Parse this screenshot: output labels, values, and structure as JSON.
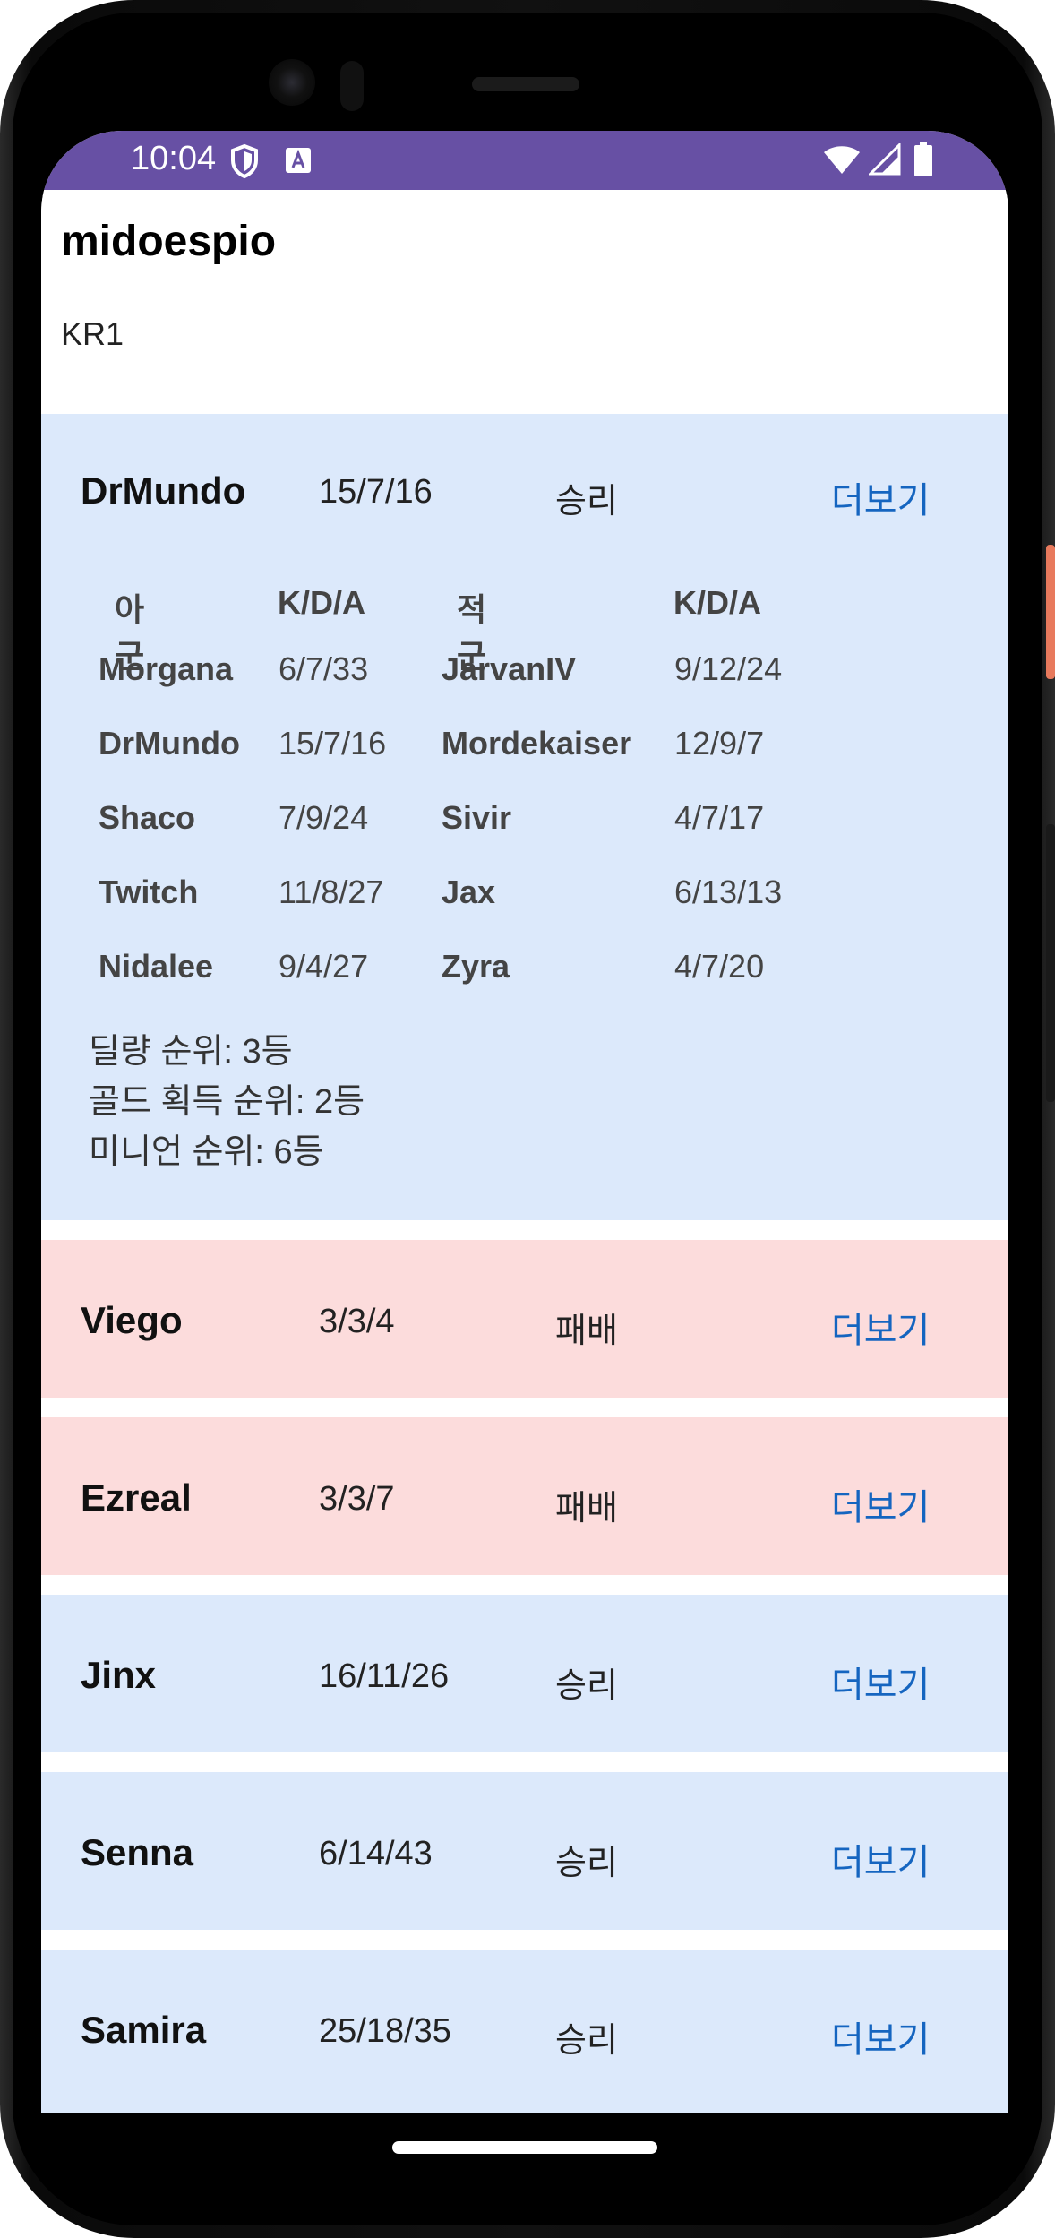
{
  "status_bar": {
    "time": "10:04"
  },
  "profile": {
    "summoner_name": "midoespio",
    "region": "KR1"
  },
  "expanded_match": {
    "champion": "DrMundo",
    "kda": "15/7/16",
    "result": "승리",
    "more_label": "더보기",
    "headers": {
      "ally": "아군",
      "ally_kda": "K/D/A",
      "enemy": "적군",
      "enemy_kda": "K/D/A"
    },
    "rows": [
      {
        "ally": "Morgana",
        "ally_kda": "6/7/33",
        "enemy": "JarvanIV",
        "enemy_kda": "9/12/24"
      },
      {
        "ally": "DrMundo",
        "ally_kda": "15/7/16",
        "enemy": "Mordekaiser",
        "enemy_kda": "12/9/7"
      },
      {
        "ally": "Shaco",
        "ally_kda": "7/9/24",
        "enemy": "Sivir",
        "enemy_kda": "4/7/17"
      },
      {
        "ally": "Twitch",
        "ally_kda": "11/8/27",
        "enemy": "Jax",
        "enemy_kda": "6/13/13"
      },
      {
        "ally": "Nidalee",
        "ally_kda": "9/4/27",
        "enemy": "Zyra",
        "enemy_kda": "4/7/20"
      }
    ],
    "ranks": [
      "딜량 순위: 3등",
      "골드 획득 순위: 2등",
      "미니언 순위: 6등"
    ]
  },
  "matches": [
    {
      "champion": "Viego",
      "kda": "3/3/4",
      "result": "패배",
      "more_label": "더보기"
    },
    {
      "champion": "Ezreal",
      "kda": "3/3/7",
      "result": "패배",
      "more_label": "더보기"
    },
    {
      "champion": "Jinx",
      "kda": "16/11/26",
      "result": "승리",
      "more_label": "더보기"
    },
    {
      "champion": "Senna",
      "kda": "6/14/43",
      "result": "승리",
      "more_label": "더보기"
    },
    {
      "champion": "Samira",
      "kda": "25/18/35",
      "result": "승리",
      "more_label": "더보기"
    }
  ],
  "colors": {
    "status_bar": "#6750a4",
    "win_bg": "#dce9fb",
    "loss_bg": "#fcdcdc",
    "link": "#1565c0"
  }
}
